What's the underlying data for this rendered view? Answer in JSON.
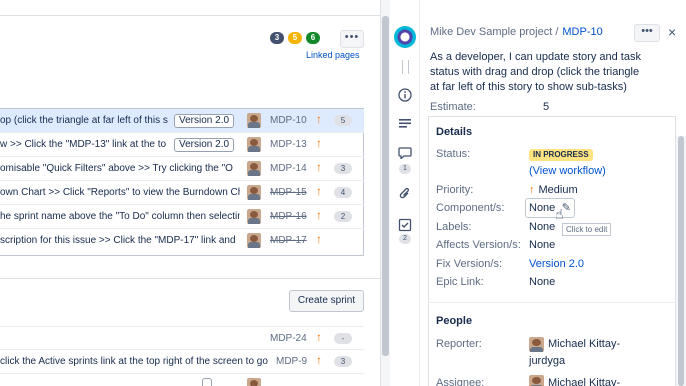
{
  "backlog": {
    "badges": [
      {
        "value": "3",
        "color": "#42526e"
      },
      {
        "value": "5",
        "color": "#f5b400"
      },
      {
        "value": "6",
        "color": "#14892c"
      }
    ],
    "more_label": "•••",
    "linked_pages": "Linked pages",
    "sprint_rows": [
      {
        "summary": "op (click the triangle at far left of this s",
        "version": "Version 2.0",
        "key": "MDP-10",
        "done": false,
        "estimate": "5",
        "selected": true
      },
      {
        "summary": "w >> Click the \"MDP-13\" link at the to",
        "version": "Version 2.0",
        "key": "MDP-13",
        "done": false,
        "estimate": "",
        "selected": false
      },
      {
        "summary": "omisable \"Quick Filters\" above >> Try clicking the \"O",
        "version": "",
        "key": "MDP-14",
        "done": false,
        "estimate": "3",
        "selected": false
      },
      {
        "summary": "own Chart >> Click \"Reports\" to view the Burndown Chart",
        "version": "",
        "key": "MDP-15",
        "done": true,
        "estimate": "4",
        "selected": false
      },
      {
        "summary": "he sprint name above the \"To Do\" column then selecting \"(",
        "version": "",
        "key": "MDP-16",
        "done": true,
        "estimate": "2",
        "selected": false
      },
      {
        "summary": "scription for this issue >> Click the \"MDP-17\" link and",
        "version": "",
        "key": "MDP-17",
        "done": true,
        "estimate": "",
        "selected": false
      }
    ],
    "create_sprint": "Create sprint",
    "backlog_rows": [
      {
        "summary": "",
        "key": "MDP-24",
        "estimate": "-",
        "version": ""
      },
      {
        "summary": "click the Active sprints link at the top right of the screen to go",
        "key": "MDP-9",
        "estimate": "3",
        "version": ""
      }
    ]
  },
  "detail": {
    "project": "Mike Dev Sample project /",
    "issue_key": "MDP-10",
    "more_label": "•••",
    "close": "×",
    "description": "As a developer, I can update story and task status with drag and drop (click the triangle at far left of this story to show sub-tasks)",
    "estimate_label": "Estimate:",
    "estimate_value": "5",
    "rail": {
      "comments_count": "1",
      "subtasks_count": "2"
    },
    "details_title": "Details",
    "fields": {
      "status_label": "Status:",
      "status_value": "IN PROGRESS",
      "view_workflow": "(View workflow)",
      "priority_label": "Priority:",
      "priority_value": "Medium",
      "components_label": "Component/s:",
      "components_value": "None",
      "click_to_edit": "Click to edit",
      "labels_label": "Labels:",
      "labels_value": "None",
      "affects_label": "Affects Version/s:",
      "affects_value": "None",
      "fix_label": "Fix Version/s:",
      "fix_value": "Version 2.0",
      "epic_label": "Epic Link:",
      "epic_value": "None"
    },
    "people_title": "People",
    "reporter_label": "Reporter:",
    "reporter_name_1": "Michael Kittay-",
    "reporter_name_2": "jurdyga",
    "assignee_label": "Assignee:",
    "assignee_name": "Michael Kittay-"
  },
  "colors": {
    "accent": "#0052cc",
    "priority": "#ff7a00",
    "status": "#ffe380",
    "selected_row": "#deebff"
  }
}
